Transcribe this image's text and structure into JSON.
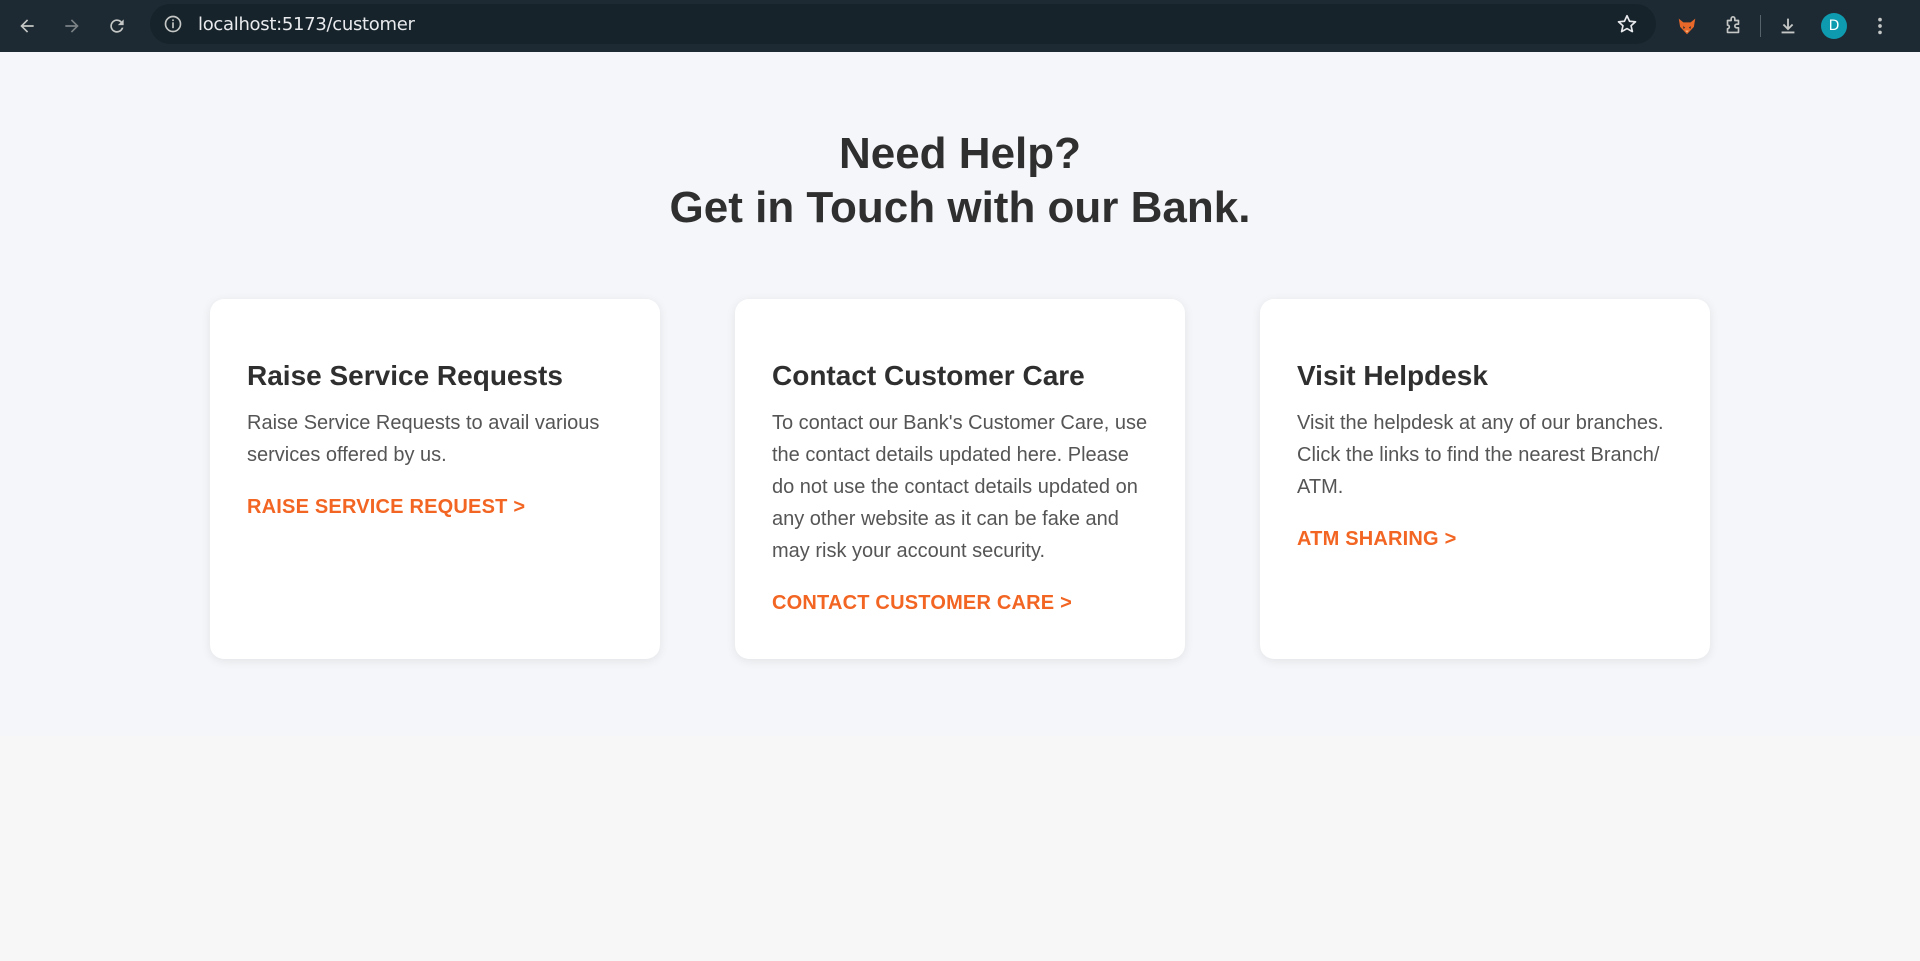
{
  "browser": {
    "url": "localhost:5173/customer",
    "avatar_letter": "D",
    "icons": [
      "back-icon",
      "forward-icon",
      "reload-icon",
      "site-info-icon",
      "bookmark-star-icon",
      "fox-extension-icon",
      "extensions-puzzle-icon",
      "download-icon",
      "profile-avatar",
      "more-menu-icon"
    ]
  },
  "page": {
    "headline_line1": "Need Help?",
    "headline_line2": "Get in Touch with our Bank.",
    "cards": [
      {
        "title": "Raise Service Requests",
        "text": "Raise Service Requests to avail various services offered by us.",
        "link": "RAISE SERVICE REQUEST >"
      },
      {
        "title": "Contact Customer Care",
        "text": "To contact our Bank's Customer Care, use the contact details updated here. Please do not use the contact details updated on any other website as it can be fake and may risk your account security.",
        "link": "CONTACT CUSTOMER CARE >"
      },
      {
        "title": "Visit Helpdesk",
        "text": "Visit the helpdesk at any of our branches. Click the links to find the nearest Branch/ ATM.",
        "link": "ATM SHARING >"
      }
    ]
  },
  "colors": {
    "accent": "#f26522",
    "chrome": "#1e2a33",
    "avatar": "#0e9bb0"
  }
}
